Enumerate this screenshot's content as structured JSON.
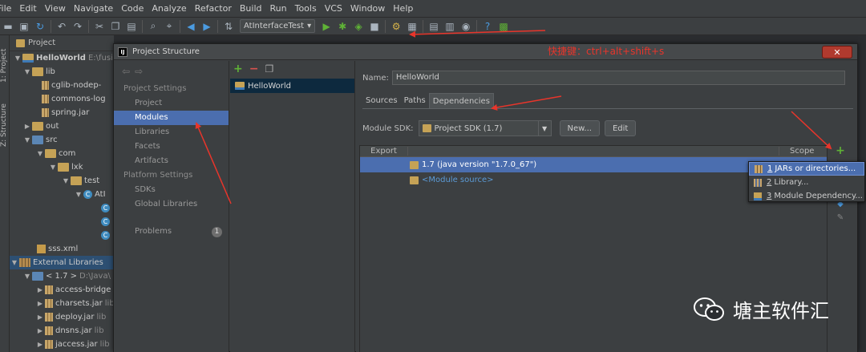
{
  "menu": [
    "File",
    "Edit",
    "View",
    "Navigate",
    "Code",
    "Analyze",
    "Refactor",
    "Build",
    "Run",
    "Tools",
    "VCS",
    "Window",
    "Help"
  ],
  "toolbar": {
    "run_config": "AtInterfaceTest"
  },
  "tool_stripe": {
    "project": "1: Project",
    "structure": "Z: Structure"
  },
  "project_panel": {
    "header": "Project",
    "tree": [
      {
        "label": "HelloWorld",
        "sub": "E:\\fusi"
      },
      {
        "label": "lib"
      },
      {
        "label": "cglib-nodep-"
      },
      {
        "label": "commons-log"
      },
      {
        "label": "spring.jar"
      },
      {
        "label": "out"
      },
      {
        "label": "src"
      },
      {
        "label": "com"
      },
      {
        "label": "lxk"
      },
      {
        "label": "test"
      },
      {
        "label": "AtI"
      },
      {
        "label": "sss.xml"
      },
      {
        "label": "External Libraries"
      },
      {
        "label": "< 1.7 >",
        "sub": "D:\\Java\\"
      },
      {
        "label": "access-bridge",
        "sub": ""
      },
      {
        "label": "charsets.jar",
        "sub": "lib"
      },
      {
        "label": "deploy.jar",
        "sub": "lib"
      },
      {
        "label": "dnsns.jar",
        "sub": "lib"
      },
      {
        "label": "jaccess.jar",
        "sub": "lib"
      }
    ]
  },
  "dialog": {
    "title": "Project Structure",
    "annotation_shortcut": "快捷键：ctrl+alt+shift+s",
    "nav": {
      "section_project": "Project Settings",
      "project_items": [
        "Project",
        "Modules",
        "Libraries",
        "Facets",
        "Artifacts"
      ],
      "section_platform": "Platform Settings",
      "platform_items": [
        "SDKs",
        "Global Libraries"
      ],
      "problems": "Problems",
      "problems_count": "1"
    },
    "module": "HelloWorld",
    "name_label": "Name:",
    "name_value": "HelloWorld",
    "tabs": [
      "Sources",
      "Paths",
      "Dependencies"
    ],
    "sdk_label": "Module SDK:",
    "sdk_value": "Project SDK (1.7)",
    "new_button": "New...",
    "edit_button": "Edit",
    "table_headers": {
      "export": "Export",
      "scope": "Scope"
    },
    "dependencies": [
      "1.7 (java version \"1.7.0_67\")",
      "<Module source>"
    ]
  },
  "popup": [
    {
      "num": "1",
      "label": " JARs or directories..."
    },
    {
      "num": "2",
      "label": " Library..."
    },
    {
      "num": "3",
      "label": " Module Dependency..."
    }
  ],
  "watermark": "塘主软件汇",
  "colors": {
    "accent": "#4b6eaf",
    "annotation": "#e8352b",
    "green": "#5fb236"
  }
}
